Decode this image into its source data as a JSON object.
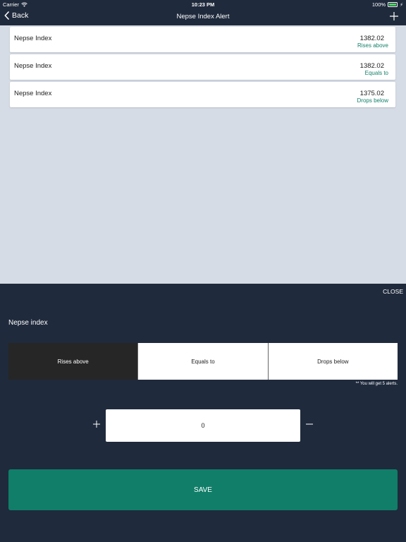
{
  "status_bar": {
    "carrier": "Carrier",
    "time": "10:23 PM",
    "battery": "100%"
  },
  "nav": {
    "back_label": "Back",
    "title": "Nepse Index Alert"
  },
  "alerts": [
    {
      "name": "Nepse Index",
      "value": "1382.02",
      "condition": "Rises above"
    },
    {
      "name": "Nepse Index",
      "value": "1382.02",
      "condition": "Equals to"
    },
    {
      "name": "Nepse Index",
      "value": "1375.02",
      "condition": "Drops below"
    }
  ],
  "panel": {
    "close_label": "CLOSE",
    "title": "Nepse index",
    "segments": [
      "Rises above",
      "Equals to",
      "Drops below"
    ],
    "selected_segment": "Rises above",
    "note": "** You will get 5 alerts.",
    "quantity_value": "0",
    "save_label": "SAVE"
  },
  "colors": {
    "nav_background": "#1f2a3c",
    "content_background": "#d6dce5",
    "accent_green": "#117e69",
    "selected_segment": "#262626"
  }
}
